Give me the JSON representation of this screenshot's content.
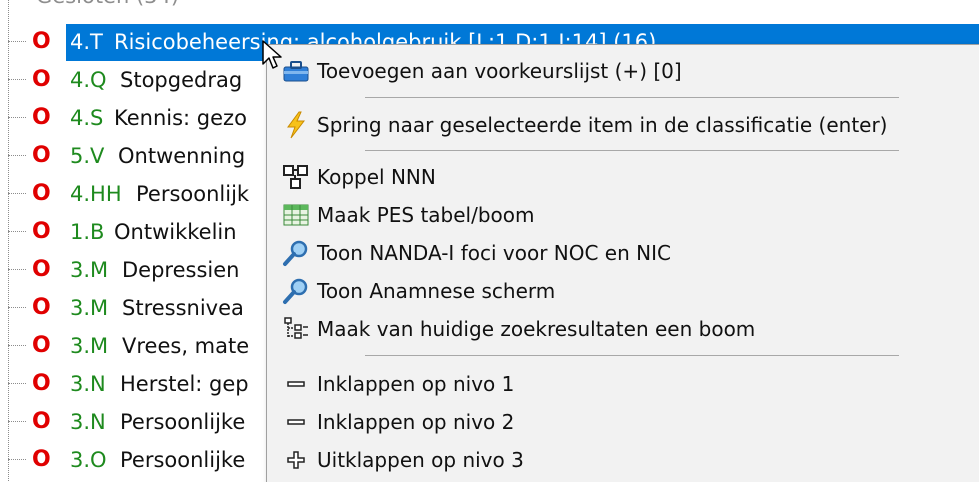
{
  "tree": {
    "top_partial_label": "Gesloten (34)",
    "rows": [
      {
        "marker": "O",
        "code": "4.T",
        "label": "Risicobeheersing: alcoholgebruik [L:1 D:1 I:14] (16)",
        "selected": true
      },
      {
        "marker": "O",
        "code": "4.Q",
        "label": "Stopgedrag"
      },
      {
        "marker": "O",
        "code": "4.S",
        "label": "Kennis: gezo"
      },
      {
        "marker": "O",
        "code": "5.V",
        "label": "Ontwenning"
      },
      {
        "marker": "O",
        "code": "4.HH",
        "label": "Persoonlijk"
      },
      {
        "marker": "O",
        "code": "1.B",
        "label": "Ontwikkelin"
      },
      {
        "marker": "O",
        "code": "3.M",
        "label": "Depressien"
      },
      {
        "marker": "O",
        "code": "3.M",
        "label": "Stressnivea"
      },
      {
        "marker": "O",
        "code": "3.M",
        "label": "Vrees, mate"
      },
      {
        "marker": "O",
        "code": "3.N",
        "label": "Herstel: gep"
      },
      {
        "marker": "O",
        "code": "3.N",
        "label": "Persoonlijke"
      },
      {
        "marker": "O",
        "code": "3.O",
        "label": "Persoonlijke"
      }
    ]
  },
  "context_menu": {
    "items": [
      {
        "label": "Toevoegen aan voorkeurslijst (+) [0]",
        "icon": "toolbox-icon"
      },
      {
        "label": "Spring naar geselecteerde item in de classificatie (enter)",
        "icon": "lightning-icon"
      },
      {
        "label": "Koppel NNN",
        "icon": "network-icon"
      },
      {
        "label": "Maak PES tabel/boom",
        "icon": "table-icon"
      },
      {
        "label": "Toon NANDA-I foci voor NOC en NIC",
        "icon": "magnifier-icon"
      },
      {
        "label": "Toon Anamnese scherm",
        "icon": "magnifier-icon"
      },
      {
        "label": "Maak van huidige zoekresultaten een boom",
        "icon": "tree-icon"
      },
      {
        "label": "Inklappen op nivo 1",
        "icon": "minus-icon"
      },
      {
        "label": "Inklappen op nivo 2",
        "icon": "minus-icon"
      },
      {
        "label": "Uitklappen op nivo 3",
        "icon": "plus-icon"
      }
    ]
  },
  "colors": {
    "selection": "#0078d7",
    "marker": "#e00000",
    "code": "#1e8a1e",
    "menu_background": "#f2f2f2"
  }
}
